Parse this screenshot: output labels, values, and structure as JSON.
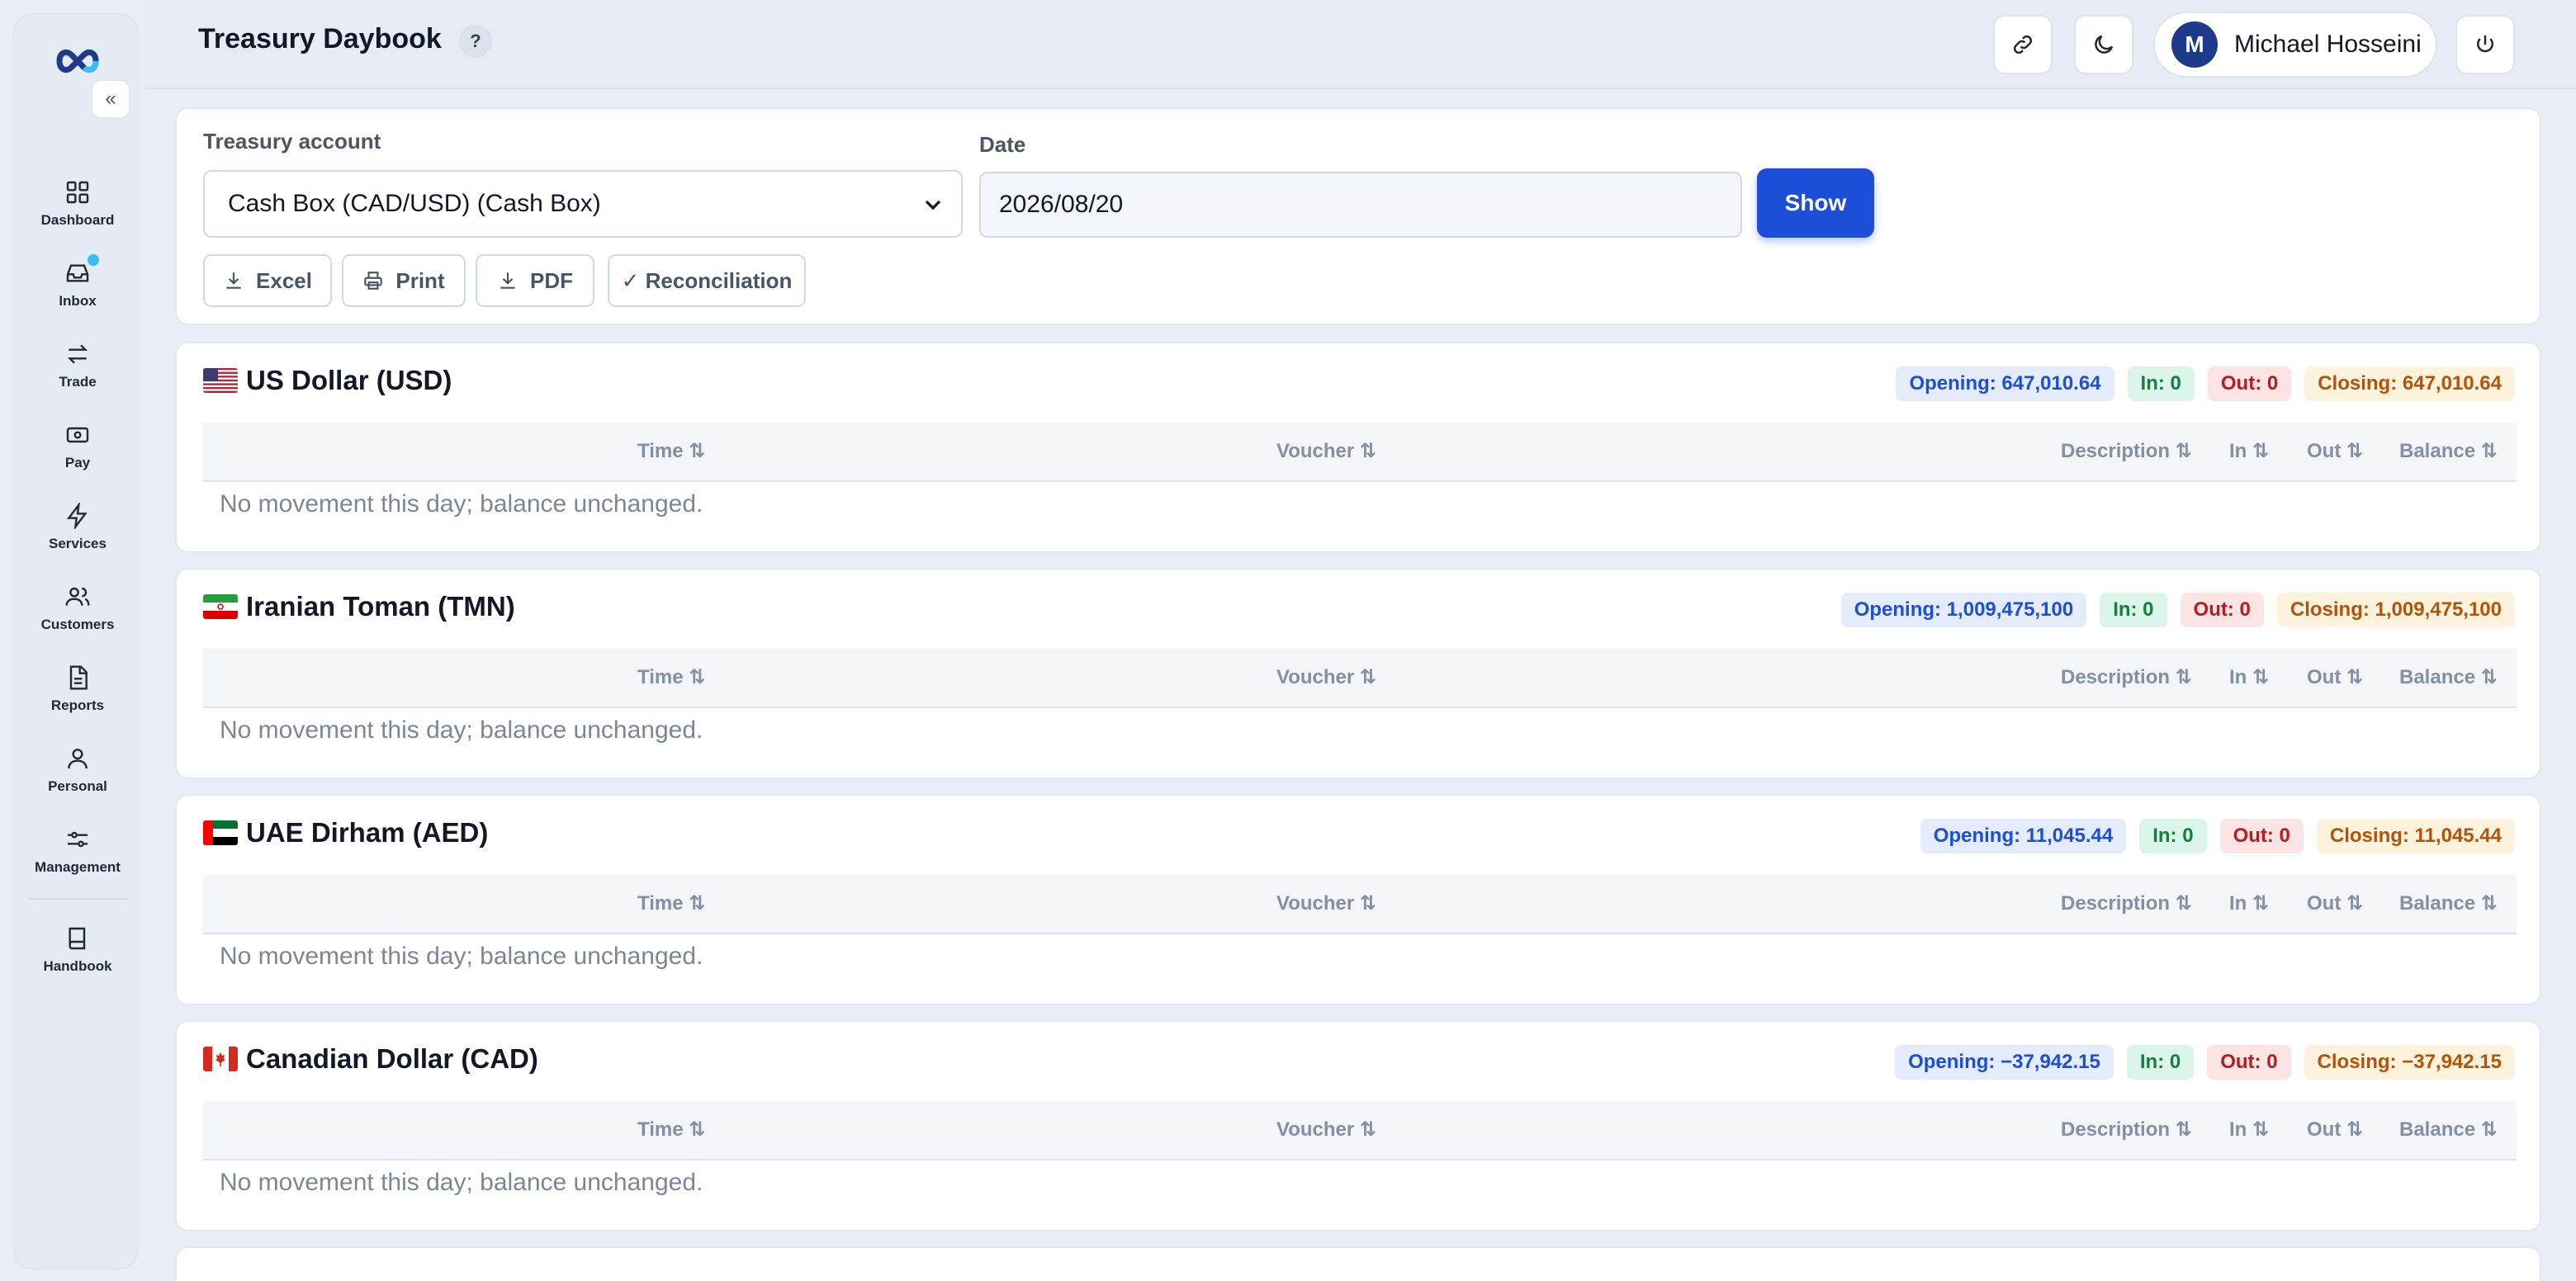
{
  "sidebar": {
    "items": [
      {
        "label": "Dashboard",
        "icon": "dashboard-icon"
      },
      {
        "label": "Inbox",
        "icon": "inbox-icon"
      },
      {
        "label": "Trade",
        "icon": "trade-icon"
      },
      {
        "label": "Pay",
        "icon": "pay-icon"
      },
      {
        "label": "Services",
        "icon": "lightning-icon"
      },
      {
        "label": "Customers",
        "icon": "users-icon"
      },
      {
        "label": "Reports",
        "icon": "report-icon"
      },
      {
        "label": "Personal",
        "icon": "user-icon"
      },
      {
        "label": "Management",
        "icon": "sliders-icon"
      }
    ],
    "handbook": {
      "label": "Handbook",
      "icon": "book-icon"
    }
  },
  "header": {
    "title": "Treasury Daybook",
    "help": "?",
    "user": {
      "initial": "M",
      "name": "Michael Hosseini"
    }
  },
  "filters": {
    "account_label": "Treasury account",
    "account_value": "Cash Box (CAD/USD) (Cash Box)",
    "date_label": "Date",
    "date_value": "2026/08/20",
    "show_label": "Show",
    "excel_label": "Excel",
    "print_label": "Print",
    "pdf_label": "PDF",
    "reconciliation_label": "✓ Reconciliation"
  },
  "table_headers": {
    "time": "Time ⇅",
    "voucher": "Voucher ⇅",
    "description": "Description ⇅",
    "in": "In ⇅",
    "out": "Out ⇅",
    "balance": "Balance ⇅"
  },
  "currencies": [
    {
      "name": "US Dollar (USD)",
      "opening": "Opening: 647,010.64",
      "in": "In: 0",
      "out": "Out: 0",
      "closing": "Closing: 647,010.64",
      "empty": "No movement this day; balance unchanged."
    },
    {
      "name": "Iranian Toman (TMN)",
      "opening": "Opening: 1,009,475,100",
      "in": "In: 0",
      "out": "Out: 0",
      "closing": "Closing: 1,009,475,100",
      "empty": "No movement this day; balance unchanged."
    },
    {
      "name": "UAE Dirham (AED)",
      "opening": "Opening: 11,045.44",
      "in": "In: 0",
      "out": "Out: 0",
      "closing": "Closing: 11,045.44",
      "empty": "No movement this day; balance unchanged."
    },
    {
      "name": "Canadian Dollar (CAD)",
      "opening": "Opening: −37,942.15",
      "in": "In: 0",
      "out": "Out: 0",
      "closing": "Closing: −37,942.15",
      "empty": "No movement this day; balance unchanged."
    }
  ],
  "colors": {
    "accent": "#1d4ed8",
    "opening": "#1d4ed8",
    "in": "#15803d",
    "out": "#b91c1c",
    "closing": "#b45309",
    "notification_dot": "#38bdf8"
  }
}
